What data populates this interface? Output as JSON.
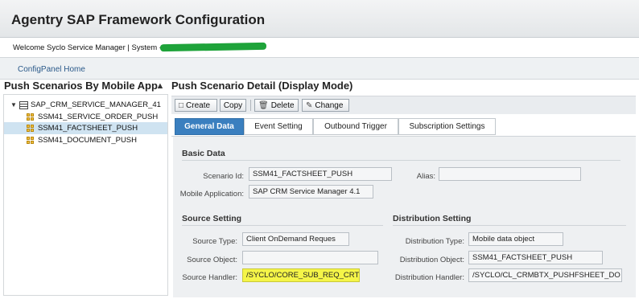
{
  "app": {
    "title": "Agentry SAP Framework Configuration"
  },
  "welcome": {
    "text": "Welcome Syclo Service Manager | System - "
  },
  "nav": {
    "home_link": "ConfigPanel Home"
  },
  "left_panel": {
    "title": "Push Scenarios By Mobile App",
    "collapse_icon": "collapse-icon",
    "tree": {
      "root": "SAP_CRM_SERVICE_MANAGER_41",
      "children": [
        "SSM41_SERVICE_ORDER_PUSH",
        "SSM41_FACTSHEET_PUSH",
        "SSM41_DOCUMENT_PUSH"
      ],
      "selected": "SSM41_FACTSHEET_PUSH"
    }
  },
  "detail": {
    "title": "Push Scenario Detail (Display Mode)",
    "toolbar": {
      "create": "Create",
      "copy": "Copy",
      "delete": "Delete",
      "change": "Change"
    },
    "tabs": [
      "General Data",
      "Event Setting",
      "Outbound Trigger",
      "Subscription Settings"
    ],
    "active_tab": "General Data",
    "basic_data": {
      "title": "Basic Data",
      "scenario_id_label": "Scenario Id:",
      "scenario_id": "SSM41_FACTSHEET_PUSH",
      "alias_label": "Alias:",
      "alias": "",
      "mobile_app_label": "Mobile Application:",
      "mobile_app": "SAP CRM Service Manager 4.1"
    },
    "source_setting": {
      "title": "Source Setting",
      "source_type_label": "Source Type:",
      "source_type": "Client OnDemand Reques",
      "source_object_label": "Source Object:",
      "source_object": "",
      "source_handler_label": "Source Handler:",
      "source_handler": "/SYCLO/CORE_SUB_REQ_CRT"
    },
    "distribution_setting": {
      "title": "Distribution Setting",
      "distribution_type_label": "Distribution Type:",
      "distribution_type": "Mobile data object",
      "distribution_object_label": "Distribution Object:",
      "distribution_object": "SSM41_FACTSHEET_PUSH",
      "distribution_handler_label": "Distribution Handler:",
      "distribution_handler": "/SYCLO/CL_CRMBTX_PUSHFSHEET_DO"
    }
  },
  "colors": {
    "accent_tab": "#3a7fbf",
    "selection": "#cfe3f1",
    "highlight": "#f5f548",
    "redaction": "#1ea33a"
  }
}
